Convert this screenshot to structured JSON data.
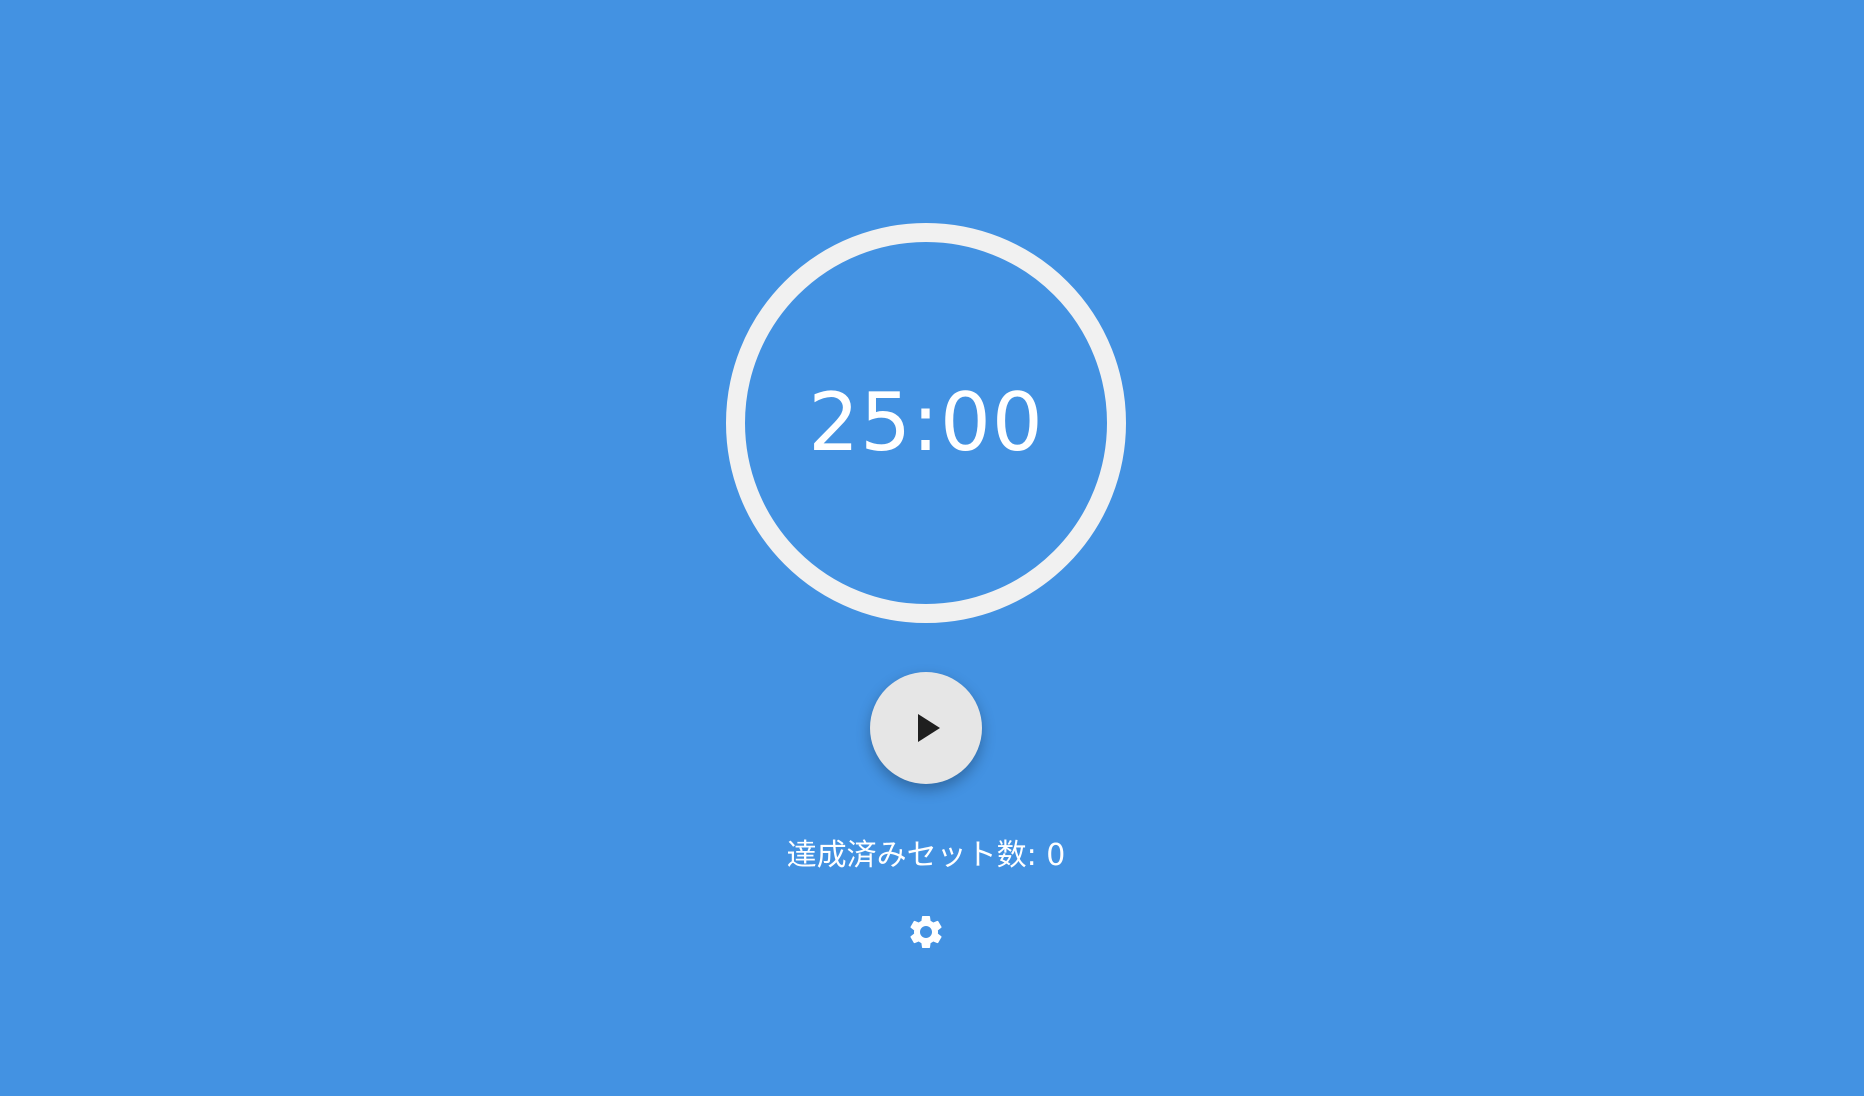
{
  "timer": {
    "display": "25:00"
  },
  "controls": {
    "play_icon": "play-icon",
    "settings_icon": "gear-icon"
  },
  "stats": {
    "completed_sets_label": "達成済みセット数:",
    "completed_sets_value": "0"
  },
  "colors": {
    "background": "#4392e2",
    "ring": "#f1f1f1",
    "button": "#e6e6e6",
    "text": "#ffffff"
  }
}
